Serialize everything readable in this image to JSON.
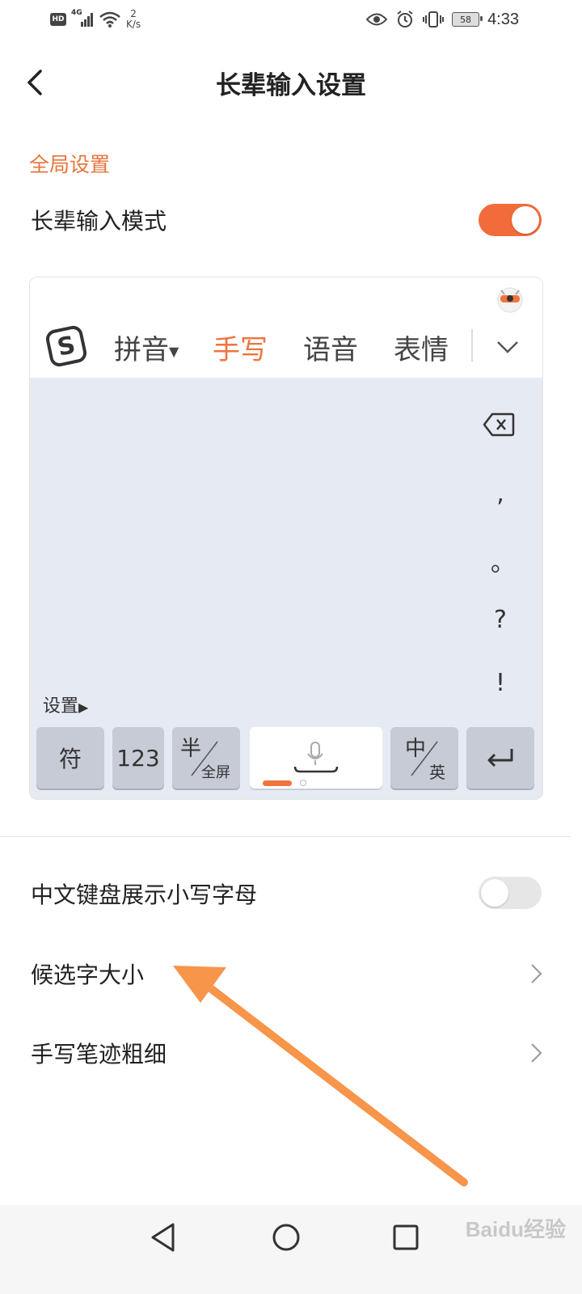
{
  "status_bar": {
    "hd_label": "HD",
    "network": "4G",
    "speed_value": "2",
    "speed_unit": "K/s",
    "battery": "58",
    "time": "4:33"
  },
  "header": {
    "title": "长辈输入设置"
  },
  "global_section": {
    "label": "全局设置",
    "elder_mode_label": "长辈输入模式",
    "elder_mode_on": true
  },
  "keyboard_preview": {
    "tabs": [
      {
        "label": "拼音"
      },
      {
        "label": "手写"
      },
      {
        "label": "语音"
      },
      {
        "label": "表情"
      }
    ],
    "punctuation": [
      ",",
      "。",
      "?",
      "!"
    ],
    "settings_label": "设置",
    "keys": {
      "symbol": "符",
      "number": "123",
      "half_main": "半",
      "half_sub": "全屏",
      "cn_main": "中",
      "cn_sub": "英"
    }
  },
  "settings_list": [
    {
      "label": "中文键盘展示小写字母"
    },
    {
      "label": "候选字大小"
    },
    {
      "label": "手写笔迹粗细"
    }
  ],
  "lowercase_toggle_on": false,
  "colors": {
    "accent": "#f26b3a",
    "annotation_arrow": "#f7954a"
  },
  "watermark": "Baidu经验"
}
